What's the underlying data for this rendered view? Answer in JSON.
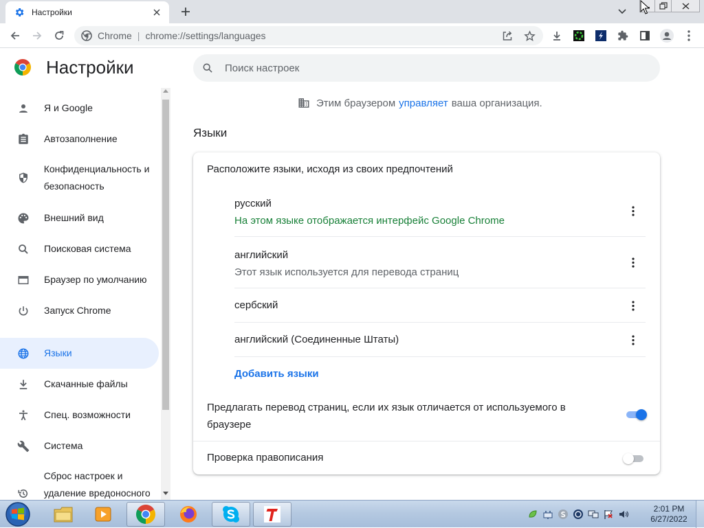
{
  "tab": {
    "title": "Настройки"
  },
  "omnibox": {
    "site_label": "Chrome",
    "url": "chrome://settings/languages"
  },
  "header": {
    "title": "Настройки"
  },
  "search": {
    "placeholder": "Поиск настроек"
  },
  "sidebar": {
    "items": [
      {
        "label": "Я и Google",
        "icon": "person-icon"
      },
      {
        "label": "Автозаполнение",
        "icon": "clipboard-icon"
      },
      {
        "label": "Конфиденциальность и безопасность",
        "icon": "shield-icon"
      },
      {
        "label": "Внешний вид",
        "icon": "palette-icon"
      },
      {
        "label": "Поисковая система",
        "icon": "search-icon"
      },
      {
        "label": "Браузер по умолчанию",
        "icon": "browser-window-icon"
      },
      {
        "label": "Запуск Chrome",
        "icon": "power-icon"
      },
      {
        "label": "Языки",
        "icon": "globe-icon",
        "active": true
      },
      {
        "label": "Скачанные файлы",
        "icon": "download-icon"
      },
      {
        "label": "Спец. возможности",
        "icon": "accessibility-icon"
      },
      {
        "label": "Система",
        "icon": "wrench-icon"
      },
      {
        "label": "Сброс настроек и удаление вредоносного",
        "icon": "history-icon"
      }
    ]
  },
  "managed": {
    "prefix": "Этим браузером",
    "link": "управляет",
    "suffix": "ваша организация."
  },
  "languages": {
    "section_title": "Языки",
    "card_heading": "Расположите языки, исходя из своих предпочтений",
    "list": [
      {
        "name": "русский",
        "description": "На этом языке отображается интерфейс Google Chrome"
      },
      {
        "name": "английский",
        "description": "Этот язык используется для перевода страниц"
      },
      {
        "name": "сербский",
        "description": ""
      },
      {
        "name": "английский (Соединенные Штаты)",
        "description": ""
      }
    ],
    "add_label": "Добавить языки",
    "offer_translate": {
      "label": "Предлагать перевод страниц, если их язык отличается от используемого в браузере",
      "enabled": true
    },
    "spellcheck": {
      "label": "Проверка правописания",
      "enabled": false
    }
  },
  "taskbar": {
    "apps": [
      "file-explorer-icon",
      "media-player-icon",
      "chrome-icon",
      "firefox-icon",
      "skype-icon",
      "t-app-icon"
    ],
    "clock_time": "2:01 PM",
    "clock_date": "6/27/2022"
  },
  "colors": {
    "accent": "#1a73e8",
    "primary_language_desc": "#188038",
    "secondary_text": "#5f6368",
    "active_nav_bg": "#e8f0fe"
  }
}
